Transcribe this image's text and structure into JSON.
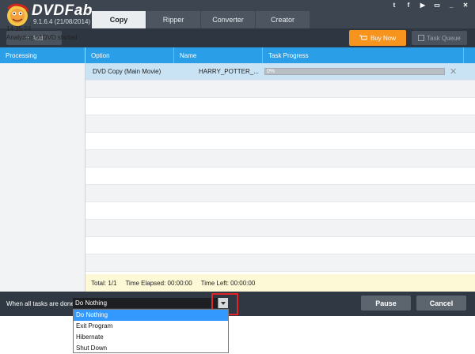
{
  "app": {
    "brand": "DVDFab",
    "version": "9.1.6.4 (21/08/2014)"
  },
  "tabs": [
    {
      "label": "Copy",
      "active": true
    },
    {
      "label": "Ripper",
      "active": false
    },
    {
      "label": "Converter",
      "active": false
    },
    {
      "label": "Creator",
      "active": false
    }
  ],
  "social_icons": [
    "twitter-icon",
    "facebook-icon",
    "youtube-icon",
    "window-icon"
  ],
  "window_controls": {
    "minimize": "_",
    "close": "✕"
  },
  "toolbar": {
    "add_label": "Add",
    "buy_now_label": "Buy Now",
    "task_queue_label": "Task Queue"
  },
  "left_panel": {
    "header": "Processing",
    "time": "14:35:24",
    "message": "Analyzing of DVD started"
  },
  "table": {
    "columns": [
      "Option",
      "Name",
      "Task Progress"
    ],
    "rows": [
      {
        "option": "DVD Copy (Main Movie)",
        "name": "HARRY_POTTER_...",
        "progress": "0%",
        "progress_fraction": 0
      }
    ]
  },
  "summary": {
    "total": "Total: 1/1",
    "elapsed": "Time Elapsed: 00:00:00",
    "left": "Time Left: 00:00:00"
  },
  "bottom": {
    "when_label": "When all tasks are done:",
    "selected": "Do Nothing",
    "pause_label": "Pause",
    "cancel_label": "Cancel"
  },
  "dropdown": {
    "options": [
      "Do Nothing",
      "Exit Program",
      "Hibernate",
      "Shut Down"
    ],
    "selected_index": 0
  },
  "colors": {
    "accent_blue": "#2a9ee6",
    "orange": "#f7941d",
    "dark_bg": "#3c4550",
    "highlight_red": "#e0242a"
  }
}
